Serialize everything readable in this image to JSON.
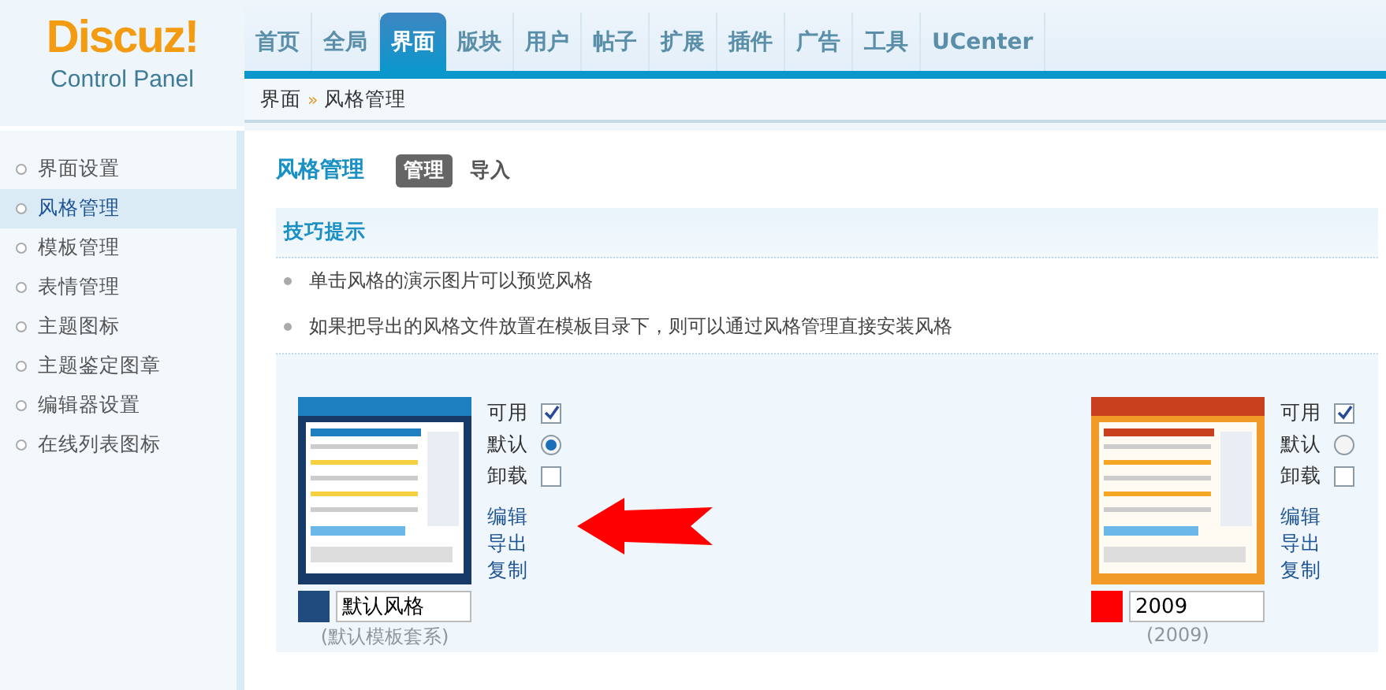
{
  "logo": {
    "title": "Discuz!",
    "subtitle": "Control Panel"
  },
  "nav": [
    {
      "label": "首页",
      "selected": false
    },
    {
      "label": "全局",
      "selected": false
    },
    {
      "label": "界面",
      "selected": true
    },
    {
      "label": "版块",
      "selected": false
    },
    {
      "label": "用户",
      "selected": false
    },
    {
      "label": "帖子",
      "selected": false
    },
    {
      "label": "扩展",
      "selected": false
    },
    {
      "label": "插件",
      "selected": false
    },
    {
      "label": "广告",
      "selected": false
    },
    {
      "label": "工具",
      "selected": false
    },
    {
      "label": "UCenter",
      "selected": false
    }
  ],
  "breadcrumb": {
    "parent": "界面",
    "separator": "»",
    "current": "风格管理"
  },
  "sidebar": {
    "items": [
      {
        "label": "界面设置",
        "selected": false
      },
      {
        "label": "风格管理",
        "selected": true
      },
      {
        "label": "模板管理",
        "selected": false
      },
      {
        "label": "表情管理",
        "selected": false
      },
      {
        "label": "主题图标",
        "selected": false
      },
      {
        "label": "主题鉴定图章",
        "selected": false
      },
      {
        "label": "编辑器设置",
        "selected": false
      },
      {
        "label": "在线列表图标",
        "selected": false
      }
    ]
  },
  "page": {
    "title": "风格管理",
    "tabs": [
      {
        "label": "管理",
        "selected": true
      },
      {
        "label": "导入",
        "selected": false
      }
    ]
  },
  "tips": {
    "title": "技巧提示",
    "items": [
      "单击风格的演示图片可以预览风格",
      "如果把导出的风格文件放置在模板目录下，则可以通过风格管理直接安装风格"
    ]
  },
  "styles": [
    {
      "kind": "blue",
      "color": "#1f4b7e",
      "name": "默认风格",
      "subtitle": "(默认模板套系)",
      "available_label": "可用",
      "available": true,
      "default_label": "默认",
      "default": true,
      "uninstall_label": "卸载",
      "uninstall": false,
      "links": [
        "编辑",
        "导出",
        "复制"
      ]
    },
    {
      "kind": "orange",
      "color": "#ff0000",
      "name": "2009",
      "subtitle": "(2009)",
      "available_label": "可用",
      "available": true,
      "default_label": "默认",
      "default": false,
      "uninstall_label": "卸载",
      "uninstall": false,
      "links": [
        "编辑",
        "导出",
        "复制"
      ]
    }
  ]
}
